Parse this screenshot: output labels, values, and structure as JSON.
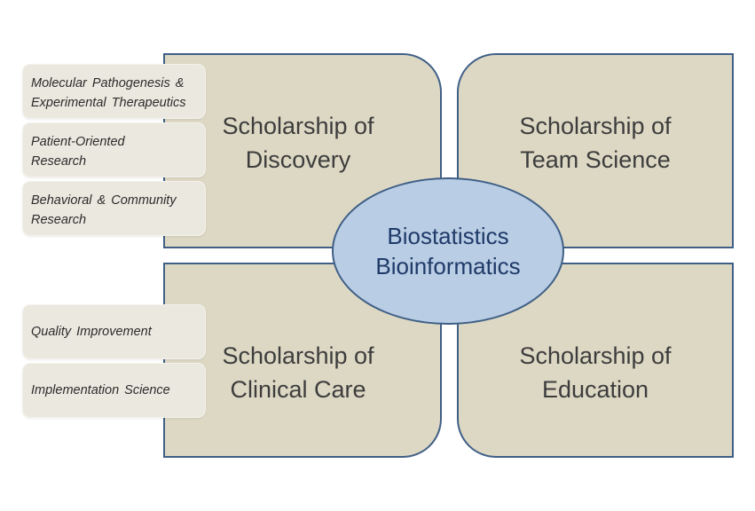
{
  "center": {
    "line1": "Biostatistics",
    "line2": "Bioinformatics"
  },
  "quadrants": {
    "top_left": {
      "line1": "Scholarship of",
      "line2": "Discovery"
    },
    "top_right": {
      "line1": "Scholarship of",
      "line2": "Team Science"
    },
    "bottom_left": {
      "line1": "Scholarship of",
      "line2": "Clinical Care"
    },
    "bottom_right": {
      "line1": "Scholarship of",
      "line2": "Education"
    }
  },
  "discovery_tags": [
    {
      "line1": "Molecular Pathogenesis &",
      "line2": "Experimental Therapeutics"
    },
    {
      "line1": "Patient-Oriented",
      "line2": "Research"
    },
    {
      "line1": "Behavioral & Community",
      "line2": "Research"
    }
  ],
  "clinical_care_tags": [
    {
      "line1": "Quality Improvement"
    },
    {
      "line1": "Implementation Science"
    }
  ],
  "colors": {
    "quadrant_fill": "#ddd8c4",
    "outline": "#3f5f86",
    "ellipse_fill": "#b9cde5",
    "ellipse_text": "#1f3a68",
    "tag_fill": "#ebe8df"
  }
}
